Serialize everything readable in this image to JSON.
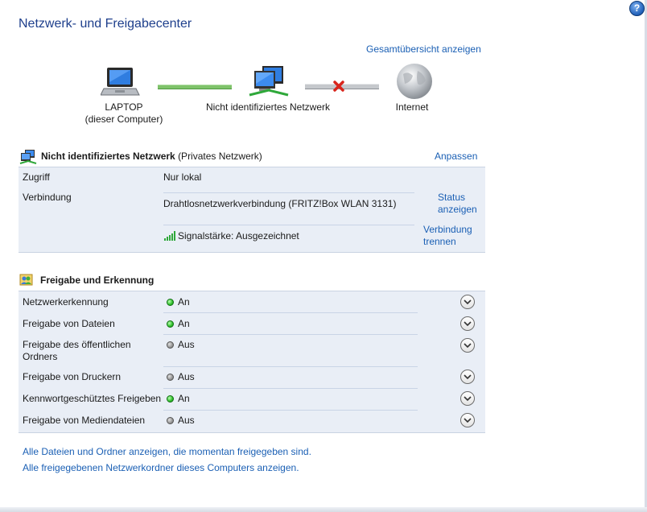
{
  "window": {
    "title": "Netzwerk- und Freigabecenter",
    "help_label": "?"
  },
  "network_map": {
    "overview_link": "Gesamtübersicht anzeigen",
    "computer_name": "LAPTOP",
    "computer_subtitle": "(dieser Computer)",
    "network_name": "Nicht identifiziertes Netzwerk",
    "internet_name": "Internet"
  },
  "network_section": {
    "name": "Nicht identifiziertes Netzwerk",
    "type": "(Privates Netzwerk)",
    "customize_link": "Anpassen",
    "access_label": "Zugriff",
    "access_value": "Nur lokal",
    "connection_label": "Verbindung",
    "connection_value": "Drahtlosnetzwerkverbindung (FRITZ!Box WLAN 3131)",
    "status_link_line1": "Status",
    "status_link_line2": "anzeigen",
    "signal_value": "Signalstärke: Ausgezeichnet",
    "disconnect_link_line1": "Verbindung",
    "disconnect_link_line2": "trennen"
  },
  "sharing_section": {
    "title": "Freigabe und Erkennung",
    "rows": [
      {
        "label_line1": "Netzwerkerkennung",
        "label_line2": "",
        "status": "An",
        "state": "on"
      },
      {
        "label_line1": "Freigabe von Dateien",
        "label_line2": "",
        "status": "An",
        "state": "on"
      },
      {
        "label_line1": "Freigabe des öffentlichen",
        "label_line2": "Ordners",
        "status": "Aus",
        "state": "off"
      },
      {
        "label_line1": "Freigabe von Druckern",
        "label_line2": "",
        "status": "Aus",
        "state": "off"
      },
      {
        "label_line1": "Kennwortgeschütztes Freigeben",
        "label_line2": "",
        "status": "An",
        "state": "on"
      },
      {
        "label_line1": "Freigabe von Mediendateien",
        "label_line2": "",
        "status": "Aus",
        "state": "off"
      }
    ]
  },
  "footer_links": {
    "shared_files": "Alle Dateien und Ordner anzeigen, die momentan freigegeben sind.",
    "shared_folders": "Alle freigegebenen Netzwerkordner dieses Computers anzeigen."
  },
  "colors": {
    "title": "#1e3f8c",
    "link": "#1a5fb4",
    "section_band": "#e9eef6",
    "status_on": "#2fbf2a",
    "status_off": "#8a8a8a"
  }
}
